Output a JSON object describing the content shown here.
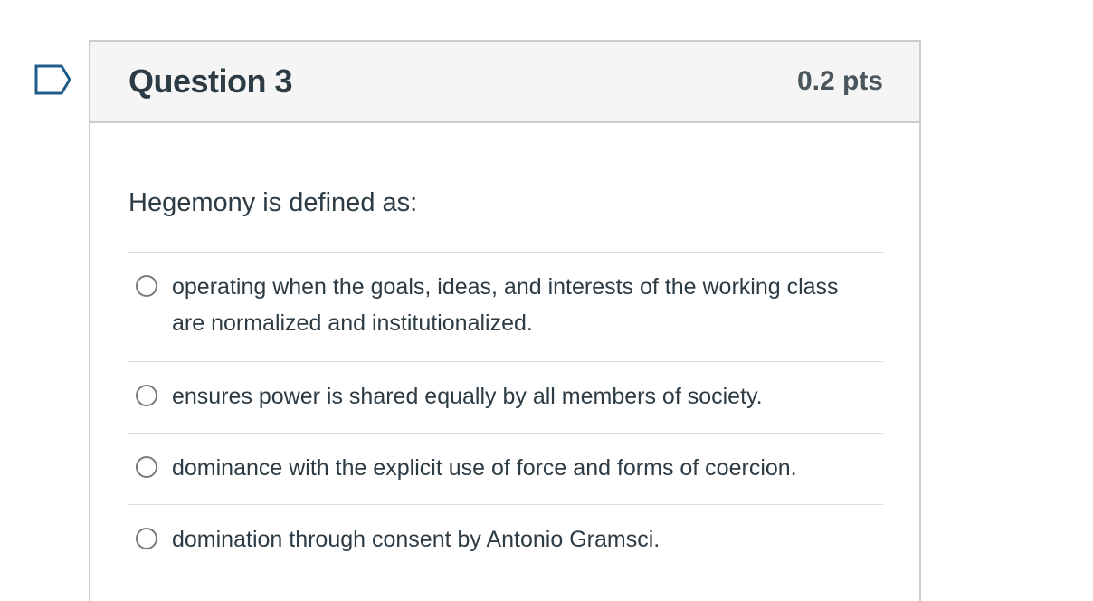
{
  "question": {
    "title": "Question 3",
    "points": "0.2 pts",
    "text": "Hegemony is defined as:",
    "flag_icon": "flag-icon",
    "answers": [
      {
        "label": "operating when the goals, ideas, and interests of the working class are normalized and institutionalized.",
        "selected": false
      },
      {
        "label": "ensures power is shared equally by all members of society.",
        "selected": false
      },
      {
        "label": "dominance with the explicit use of force and forms of coercion.",
        "selected": false
      },
      {
        "label": "domination through consent by Antonio Gramsci.",
        "selected": false
      }
    ]
  },
  "colors": {
    "header_bg": "#f5f5f5",
    "border": "#c7cdd1",
    "flag": "#1f5c8a",
    "text": "#2d3b45"
  }
}
